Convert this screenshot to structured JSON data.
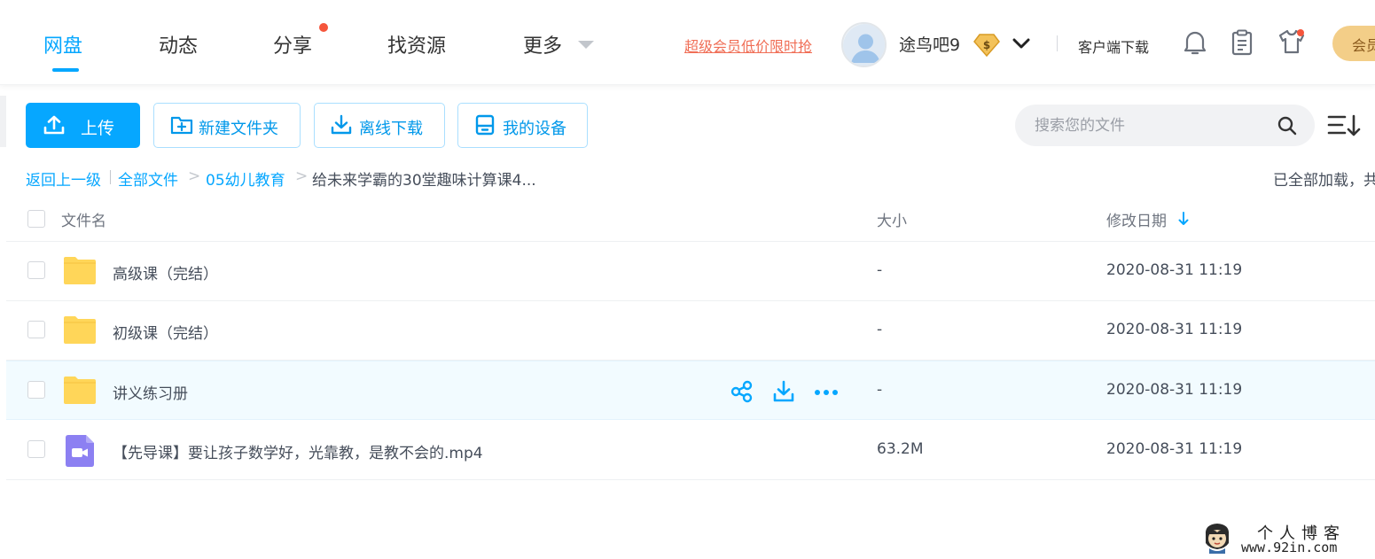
{
  "nav": {
    "items": [
      {
        "label": "网盘"
      },
      {
        "label": "动态"
      },
      {
        "label": "分享"
      },
      {
        "label": "找资源"
      },
      {
        "label": "更多"
      }
    ],
    "promo": "超级会员低价限时抢",
    "username": "途鸟吧9",
    "vip_badge": "$",
    "client_download": "客户端下载",
    "vip_button": "会员"
  },
  "toolbar": {
    "upload_label": "上传",
    "new_folder_label": "新建文件夹",
    "offline_download_label": "离线下载",
    "my_devices_label": "我的设备",
    "search_placeholder": "搜索您的文件"
  },
  "breadcrumb": {
    "back": "返回上一级",
    "items": [
      "全部文件",
      "05幼儿教育",
      "给未来学霸的30堂趣味计算课4..."
    ],
    "separator": ">",
    "status": "已全部加载，共"
  },
  "table": {
    "headers": {
      "name": "文件名",
      "size": "大小",
      "date": "修改日期"
    },
    "rows": [
      {
        "name": "高级课（完结）",
        "size": "-",
        "date": "2020-08-31 11:19",
        "type": "folder-icon"
      },
      {
        "name": "初级课（完结）",
        "size": "-",
        "date": "2020-08-31 11:19",
        "type": "folder-icon"
      },
      {
        "name": "讲义练习册",
        "size": "-",
        "date": "2020-08-31 11:19",
        "type": "folder-icon"
      },
      {
        "name": "【先导课】要让孩子数学好，光靠教，是教不会的.mp4",
        "size": "63.2M",
        "date": "2020-08-31 11:19",
        "type": "video-file-icon"
      }
    ]
  },
  "watermark": {
    "title": "个人博客",
    "url": "www.92in.com"
  },
  "colors": {
    "accent": "#06a7ff",
    "promo": "#f06e56",
    "folder": "#ffd659",
    "video": "#8c80f2",
    "notify_dot": "#f5553b",
    "vip_gold": "#f3ce88"
  }
}
